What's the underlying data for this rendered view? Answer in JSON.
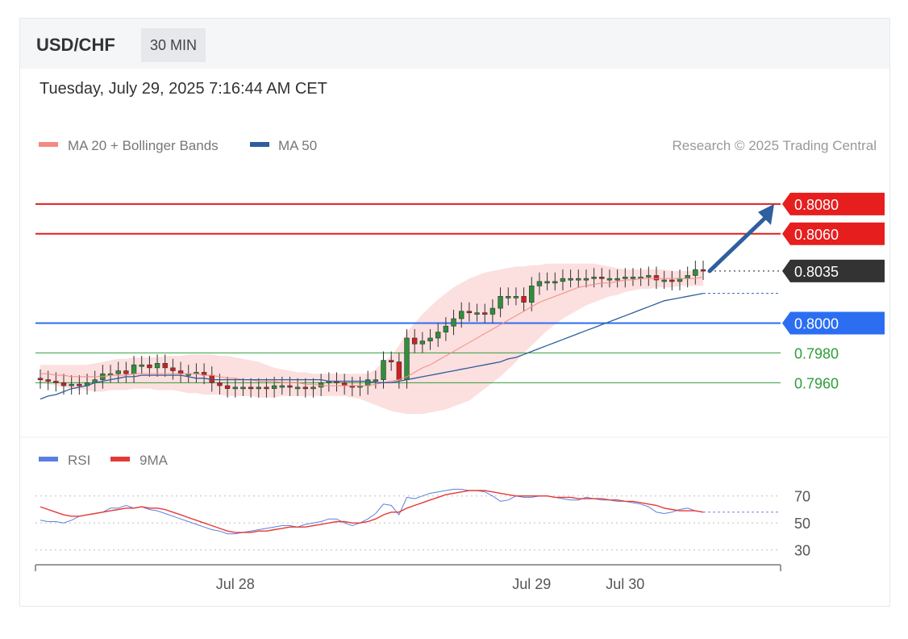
{
  "header": {
    "pair": "USD/CHF",
    "timeframe": "30 MIN"
  },
  "date": "Tuesday, July 29, 2025 7:16:44 AM CET",
  "credit": "Research © 2025 Trading Central",
  "legend": {
    "ma20": {
      "label": "MA 20 + Bollinger Bands",
      "color": "#f28b82"
    },
    "ma50": {
      "label": "MA 50",
      "color": "#2f5d9c"
    },
    "rsi": {
      "label": "RSI",
      "color": "#5b7fe0"
    },
    "rsi9": {
      "label": "9MA",
      "color": "#e53935"
    }
  },
  "levels": [
    {
      "value": 0.808,
      "label": "0.8080",
      "kind": "resistance",
      "color": "#e61e1e"
    },
    {
      "value": 0.806,
      "label": "0.8060",
      "kind": "resistance",
      "color": "#e61e1e"
    },
    {
      "value": 0.8035,
      "label": "0.8035",
      "kind": "last",
      "color": "#333333"
    },
    {
      "value": 0.8,
      "label": "0.8000",
      "kind": "pivot",
      "color": "#2b6ef2"
    },
    {
      "value": 0.798,
      "label": "0.7980",
      "kind": "support",
      "color": "#2e9e3a"
    },
    {
      "value": 0.796,
      "label": "0.7960",
      "kind": "support",
      "color": "#2e9e3a"
    }
  ],
  "rsi_levels": [
    "70",
    "50",
    "30"
  ],
  "x_labels": [
    {
      "label": "Jul 28",
      "index": 25
    },
    {
      "label": "Jul 29",
      "index": 63
    },
    {
      "label": "Jul 30",
      "index": 75
    }
  ],
  "chart_data": {
    "type": "candlestick",
    "symbol": "USD/CHF",
    "interval": "30 MIN",
    "y_range": [
      0.7945,
      0.81
    ],
    "rsi_range": [
      25,
      80
    ],
    "close": [
      0.7962,
      0.7961,
      0.796,
      0.7958,
      0.7959,
      0.7958,
      0.796,
      0.7962,
      0.7966,
      0.7966,
      0.7968,
      0.7966,
      0.7972,
      0.7972,
      0.797,
      0.7973,
      0.797,
      0.7968,
      0.7966,
      0.7966,
      0.7967,
      0.7965,
      0.796,
      0.7958,
      0.7956,
      0.7957,
      0.7957,
      0.7956,
      0.7957,
      0.7956,
      0.7958,
      0.7958,
      0.7957,
      0.7957,
      0.7956,
      0.7957,
      0.796,
      0.7961,
      0.796,
      0.7958,
      0.7957,
      0.7958,
      0.7962,
      0.7962,
      0.7975,
      0.7974,
      0.7962,
      0.799,
      0.7986,
      0.7988,
      0.799,
      0.7994,
      0.7998,
      0.8003,
      0.8008,
      0.8007,
      0.8007,
      0.8006,
      0.801,
      0.8018,
      0.8018,
      0.8018,
      0.8014,
      0.8025,
      0.8028,
      0.8028,
      0.8028,
      0.803,
      0.803,
      0.803,
      0.803,
      0.8031,
      0.803,
      0.803,
      0.803,
      0.8031,
      0.8031,
      0.8031,
      0.8032,
      0.8029,
      0.8029,
      0.8028,
      0.803,
      0.8032,
      0.8036,
      0.8035
    ],
    "ma20": [
      0.7966,
      0.7966,
      0.7965,
      0.7965,
      0.7964,
      0.7964,
      0.7964,
      0.7964,
      0.7964,
      0.7965,
      0.7965,
      0.7965,
      0.7966,
      0.7966,
      0.7966,
      0.7966,
      0.7966,
      0.7966,
      0.7966,
      0.7966,
      0.7966,
      0.7965,
      0.7965,
      0.7964,
      0.7963,
      0.7963,
      0.7962,
      0.7962,
      0.7961,
      0.7961,
      0.7961,
      0.796,
      0.796,
      0.796,
      0.7959,
      0.7959,
      0.7958,
      0.7958,
      0.7958,
      0.7958,
      0.7958,
      0.7958,
      0.7958,
      0.7959,
      0.796,
      0.7961,
      0.7962,
      0.7964,
      0.7967,
      0.797,
      0.7972,
      0.7975,
      0.7978,
      0.7981,
      0.7984,
      0.7987,
      0.799,
      0.7993,
      0.7996,
      0.7999,
      0.8002,
      0.8005,
      0.8008,
      0.8011,
      0.8014,
      0.8016,
      0.8018,
      0.802,
      0.8022,
      0.8024,
      0.8025,
      0.8026,
      0.8027,
      0.8027,
      0.8028,
      0.8029,
      0.8029,
      0.803,
      0.803,
      0.803,
      0.803,
      0.803,
      0.803,
      0.803,
      0.803,
      0.8031
    ],
    "bb_upper": [
      0.7972,
      0.7972,
      0.7972,
      0.7972,
      0.7972,
      0.7972,
      0.7972,
      0.7973,
      0.7974,
      0.7975,
      0.7976,
      0.7976,
      0.7977,
      0.7977,
      0.7977,
      0.7977,
      0.7978,
      0.7978,
      0.7978,
      0.7979,
      0.7979,
      0.7979,
      0.7979,
      0.7978,
      0.7978,
      0.7977,
      0.7976,
      0.7975,
      0.7974,
      0.7972,
      0.797,
      0.7969,
      0.7968,
      0.7967,
      0.7967,
      0.7966,
      0.7966,
      0.7966,
      0.7966,
      0.7966,
      0.7966,
      0.7966,
      0.7966,
      0.7969,
      0.7974,
      0.7978,
      0.7985,
      0.7994,
      0.8,
      0.8006,
      0.8011,
      0.8016,
      0.802,
      0.8024,
      0.8027,
      0.803,
      0.8032,
      0.8034,
      0.8035,
      0.8036,
      0.8037,
      0.8038,
      0.8038,
      0.8039,
      0.8039,
      0.804,
      0.804,
      0.804,
      0.804,
      0.804,
      0.804,
      0.804,
      0.8039,
      0.8038,
      0.8037,
      0.8036,
      0.8036,
      0.8036,
      0.8036,
      0.8036,
      0.8036,
      0.8035,
      0.8035,
      0.8035,
      0.8035,
      0.8035
    ],
    "bb_lower": [
      0.796,
      0.7959,
      0.7958,
      0.7957,
      0.7956,
      0.7955,
      0.7955,
      0.7954,
      0.7954,
      0.7955,
      0.7955,
      0.7955,
      0.7956,
      0.7956,
      0.7956,
      0.7955,
      0.7955,
      0.7955,
      0.7954,
      0.7953,
      0.7953,
      0.7952,
      0.7952,
      0.7952,
      0.7951,
      0.7951,
      0.7951,
      0.7951,
      0.795,
      0.795,
      0.795,
      0.7951,
      0.7951,
      0.7951,
      0.7951,
      0.7951,
      0.7951,
      0.7951,
      0.7951,
      0.7951,
      0.795,
      0.7949,
      0.7947,
      0.7945,
      0.7943,
      0.7941,
      0.794,
      0.7939,
      0.7939,
      0.7939,
      0.794,
      0.7941,
      0.7942,
      0.7944,
      0.7946,
      0.7948,
      0.7952,
      0.7956,
      0.796,
      0.7964,
      0.7969,
      0.7974,
      0.798,
      0.7985,
      0.799,
      0.7995,
      0.7999,
      0.8003,
      0.8006,
      0.8009,
      0.8012,
      0.8014,
      0.8016,
      0.8018,
      0.8019,
      0.8021,
      0.8022,
      0.8023,
      0.8023,
      0.8024,
      0.8024,
      0.8024,
      0.8025,
      0.8025,
      0.8025,
      0.8025
    ],
    "ma50": [
      0.7949,
      0.7951,
      0.7952,
      0.7954,
      0.7956,
      0.7957,
      0.7958,
      0.796,
      0.7961,
      0.7962,
      0.7963,
      0.7964,
      0.7964,
      0.7965,
      0.7965,
      0.7965,
      0.7965,
      0.7965,
      0.7965,
      0.7964,
      0.7963,
      0.7963,
      0.7962,
      0.7962,
      0.7962,
      0.7962,
      0.7962,
      0.7962,
      0.7962,
      0.7962,
      0.7962,
      0.7962,
      0.7962,
      0.7962,
      0.7962,
      0.7962,
      0.7962,
      0.7961,
      0.7961,
      0.7961,
      0.7961,
      0.7961,
      0.7961,
      0.796,
      0.796,
      0.796,
      0.7961,
      0.7962,
      0.7963,
      0.7964,
      0.7965,
      0.7966,
      0.7967,
      0.7968,
      0.7969,
      0.797,
      0.7971,
      0.7972,
      0.7973,
      0.7974,
      0.7976,
      0.7977,
      0.7979,
      0.7981,
      0.7983,
      0.7985,
      0.7987,
      0.7989,
      0.7991,
      0.7993,
      0.7995,
      0.7997,
      0.7999,
      0.8001,
      0.8003,
      0.8005,
      0.8007,
      0.8009,
      0.8011,
      0.8013,
      0.8015,
      0.8016,
      0.8017,
      0.8018,
      0.8019,
      0.802
    ],
    "rsi": [
      52,
      51,
      51,
      50,
      52,
      55,
      56,
      57,
      58,
      61,
      61,
      63,
      61,
      62,
      60,
      59,
      57,
      55,
      53,
      51,
      49,
      47,
      45,
      44,
      42,
      42,
      43,
      44,
      45,
      46,
      47,
      48,
      48,
      47,
      49,
      50,
      51,
      53,
      53,
      50,
      48,
      50,
      53,
      57,
      64,
      63,
      56,
      69,
      68,
      70,
      72,
      73,
      74,
      75,
      75,
      74,
      74,
      73,
      70,
      66,
      67,
      70,
      69,
      69,
      70,
      70,
      69,
      68,
      67,
      67,
      69,
      68,
      67,
      67,
      66,
      66,
      65,
      64,
      62,
      58,
      57,
      58,
      60,
      61,
      59,
      58
    ],
    "rsi9": [
      62,
      60,
      58,
      56,
      55,
      55,
      56,
      57,
      58,
      59,
      60,
      61,
      61,
      62,
      61,
      61,
      60,
      58,
      56,
      54,
      52,
      50,
      48,
      46,
      44,
      43,
      43,
      43,
      44,
      44,
      45,
      46,
      47,
      47,
      47,
      48,
      49,
      50,
      51,
      51,
      50,
      50,
      51,
      53,
      56,
      58,
      58,
      61,
      63,
      65,
      67,
      69,
      71,
      72,
      73,
      74,
      74,
      74,
      73,
      72,
      71,
      70,
      70,
      70,
      70,
      70,
      69,
      69,
      69,
      68,
      68,
      68,
      68,
      67,
      67,
      66,
      66,
      65,
      64,
      63,
      61,
      60,
      59,
      59,
      59,
      58
    ]
  }
}
